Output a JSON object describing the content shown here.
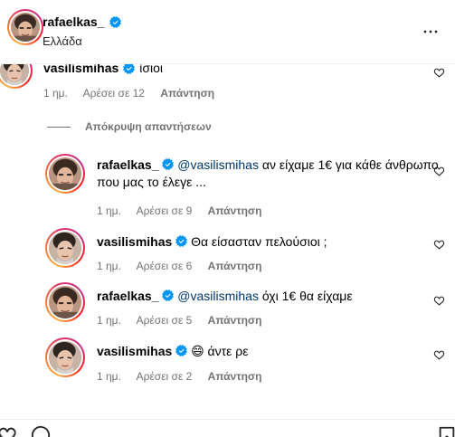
{
  "header": {
    "username": "rafaelkas_",
    "location": "Ελλάδα"
  },
  "hide_replies_label": "Απόκρυψη απαντήσεων",
  "comments": [
    {
      "user": "vasilismihas",
      "mention": "",
      "text": "ίσιοι",
      "time": "1 ημ.",
      "likes": "Αρέσει σε 12",
      "reply": "Απάντηση"
    },
    {
      "user": "rafaelkas_",
      "mention": "@vasilismihas",
      "text": " αν είχαμε 1€ για κάθε άνθρωπο που μας το έλεγε ...",
      "time": "1 ημ.",
      "likes": "Αρέσει σε 9",
      "reply": "Απάντηση"
    },
    {
      "user": "vasilismihas",
      "mention": "",
      "text": "Θα είσασταν πελούσιοι ;",
      "time": "1 ημ.",
      "likes": "Αρέσει σε 6",
      "reply": "Απάντηση"
    },
    {
      "user": "rafaelkas_",
      "mention": "@vasilismihas",
      "text": " όχι 1€ θα είχαμε",
      "time": "1 ημ.",
      "likes": "Αρέσει σε 5",
      "reply": "Απάντηση"
    },
    {
      "user": "vasilismihas",
      "mention": "",
      "text": "😄 άντε ρε",
      "time": "1 ημ.",
      "likes": "Αρέσει σε 2",
      "reply": "Απάντηση"
    }
  ],
  "icons": {
    "verified": "verified-badge-icon",
    "like": "heart-icon",
    "more": "more-options-icon"
  },
  "colors": {
    "verified": "#0095f6",
    "mention": "#00376b",
    "meta": "#737373"
  }
}
